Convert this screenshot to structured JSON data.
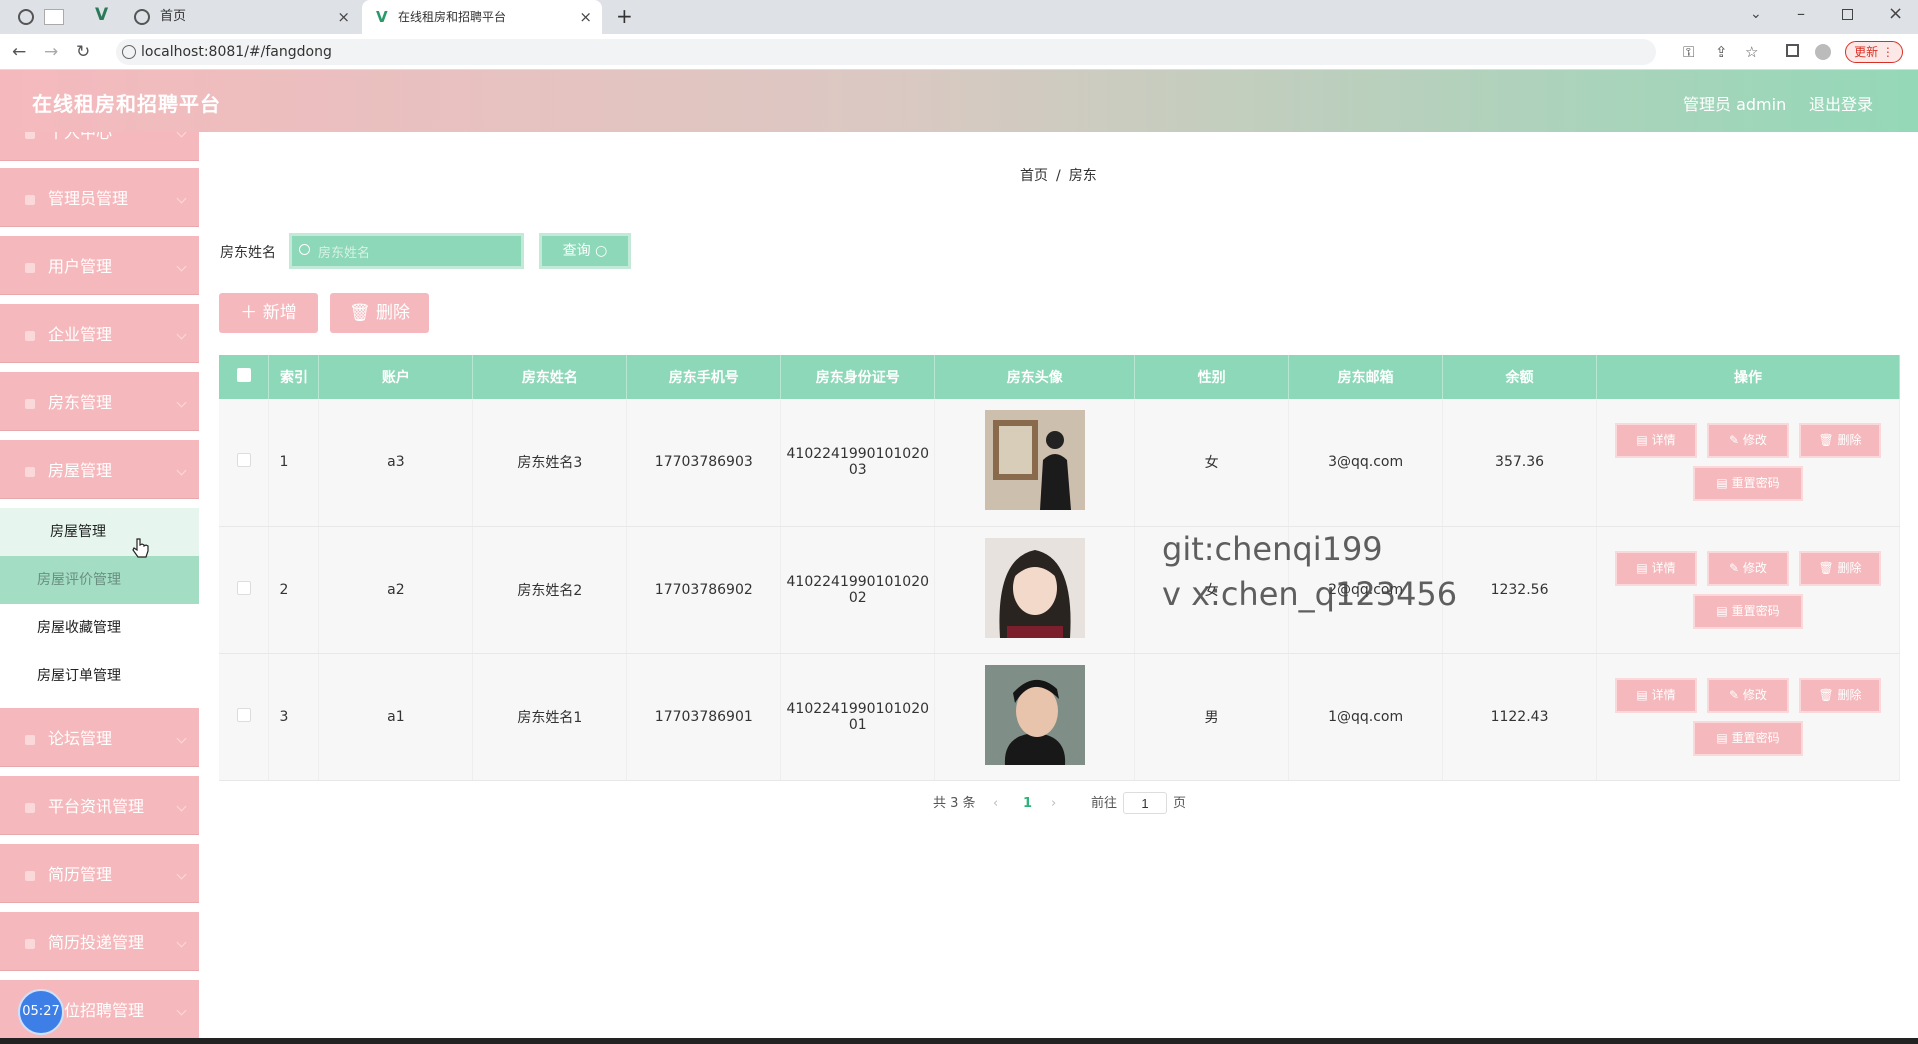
{
  "browser": {
    "tabs": [
      {
        "label": "首页"
      },
      {
        "label": "在线租房和招聘平台"
      }
    ],
    "url": "localhost:8081/#/fangdong",
    "update_label": "更新"
  },
  "header": {
    "title": "在线租房和招聘平台",
    "admin_label": "管理员 admin",
    "logout_label": "退出登录"
  },
  "sidebar": {
    "items": [
      {
        "label": "个人中心"
      },
      {
        "label": "管理员管理"
      },
      {
        "label": "用户管理"
      },
      {
        "label": "企业管理"
      },
      {
        "label": "房东管理"
      },
      {
        "label": "房屋管理"
      },
      {
        "label": "论坛管理"
      },
      {
        "label": "平台资讯管理"
      },
      {
        "label": "简历管理"
      },
      {
        "label": "简历投递管理"
      },
      {
        "label": "职位招聘管理"
      }
    ],
    "subitems": [
      {
        "label": "房屋管理"
      },
      {
        "label": "房屋评价管理"
      },
      {
        "label": "房屋收藏管理"
      },
      {
        "label": "房屋订单管理"
      }
    ],
    "timer": "05:27"
  },
  "breadcrumb": {
    "home": "首页",
    "sep": "/",
    "current": "房东"
  },
  "search": {
    "label": "房东姓名",
    "placeholder": "房东姓名",
    "button": "查询"
  },
  "actions": {
    "add": "新增",
    "delete": "删除"
  },
  "table": {
    "headers": [
      "索引",
      "账户",
      "房东姓名",
      "房东手机号",
      "房东身份证号",
      "房东头像",
      "性别",
      "房东邮箱",
      "余额",
      "操作"
    ],
    "rows": [
      {
        "index": "1",
        "account": "a3",
        "name": "房东姓名3",
        "phone": "17703786903",
        "idcard_a": "4102241990101020",
        "idcard_b": "03",
        "gender": "女",
        "email": "3@qq.com",
        "balance": "357.36"
      },
      {
        "index": "2",
        "account": "a2",
        "name": "房东姓名2",
        "phone": "17703786902",
        "idcard_a": "4102241990101020",
        "idcard_b": "02",
        "gender": "女",
        "email": "2@qq.com",
        "balance": "1232.56"
      },
      {
        "index": "3",
        "account": "a1",
        "name": "房东姓名1",
        "phone": "17703786901",
        "idcard_a": "4102241990101020",
        "idcard_b": "01",
        "gender": "男",
        "email": "1@qq.com",
        "balance": "1122.43"
      }
    ],
    "ops": {
      "detail": "详情",
      "edit": "修改",
      "delete": "删除",
      "reset": "重置密码"
    }
  },
  "pagination": {
    "total": "共 3 条",
    "current": "1",
    "goto": "前往",
    "page_value": "1",
    "page_unit": "页"
  },
  "watermark": {
    "line1": "git:chenqi199",
    "line2": "v x:chen_q123456"
  },
  "colors": {
    "pink": "#f5b9bd",
    "green": "#8dd8b8",
    "header_gradient": [
      "#f5b9bd",
      "#94d8b8"
    ]
  }
}
